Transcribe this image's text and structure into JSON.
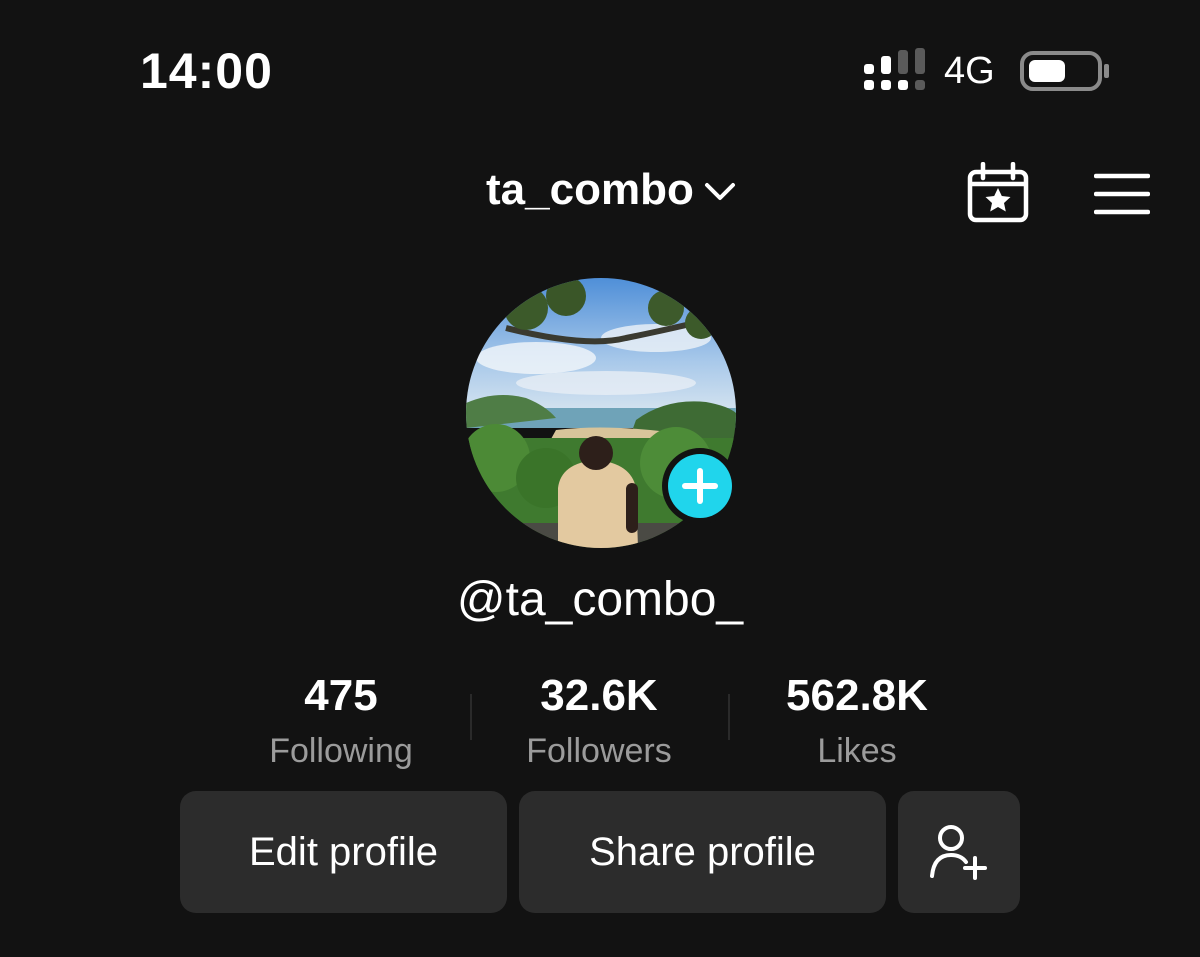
{
  "status_bar": {
    "time": "14:00",
    "network": "4G",
    "icons": [
      "signal-icon",
      "battery-icon"
    ]
  },
  "header": {
    "username": "ta_combo",
    "icons": [
      "chevron-down-icon",
      "calendar-star-icon",
      "menu-icon"
    ]
  },
  "profile": {
    "handle": "@ta_combo_",
    "avatar_icon": "avatar",
    "add_icon": "plus-icon",
    "accent_color": "#20d5ec"
  },
  "stats": [
    {
      "value": "475",
      "label": "Following"
    },
    {
      "value": "32.6K",
      "label": "Followers"
    },
    {
      "value": "562.8K",
      "label": "Likes"
    }
  ],
  "actions": {
    "edit_label": "Edit profile",
    "share_label": "Share profile",
    "add_friends_icon": "add-friend-icon"
  }
}
